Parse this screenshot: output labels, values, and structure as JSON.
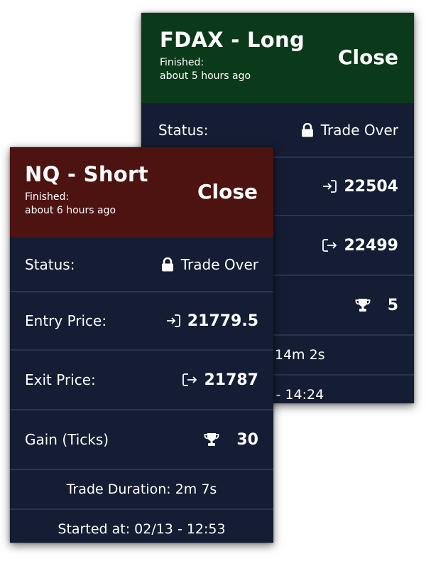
{
  "cards": {
    "back": {
      "title": "FDAX - Long",
      "finished_label": "Finished:",
      "finished_time": "about 5 hours ago",
      "close_label": "Close",
      "header_color": "#0b3a1a",
      "status_label": "Status:",
      "status_value": "Trade Over",
      "entry_value": "22504",
      "exit_value": "22499",
      "gain_value": "5",
      "duration_partial": "ation: 14m 2s",
      "started_partial": "02/13 - 14:24"
    },
    "front": {
      "title": "NQ - Short",
      "finished_label": "Finished:",
      "finished_time": "about 6 hours ago",
      "close_label": "Close",
      "header_color": "#4d1311",
      "status_label": "Status:",
      "status_value": "Trade Over",
      "entry_label": "Entry Price:",
      "entry_value": "21779.5",
      "exit_label": "Exit Price:",
      "exit_value": "21787",
      "gain_label": "Gain (Ticks)",
      "gain_value": "30",
      "duration": "Trade Duration: 2m 7s",
      "started": "Started at: 02/13 - 12:53"
    }
  },
  "icons": {
    "status": "lock-icon",
    "entry": "sign-in-icon",
    "exit": "sign-out-icon",
    "gain": "trophy-icon"
  },
  "colors": {
    "card_bg": "#141d33",
    "long_header": "#0b3a1a",
    "short_header": "#4d1311",
    "divider": "#2a3450"
  }
}
